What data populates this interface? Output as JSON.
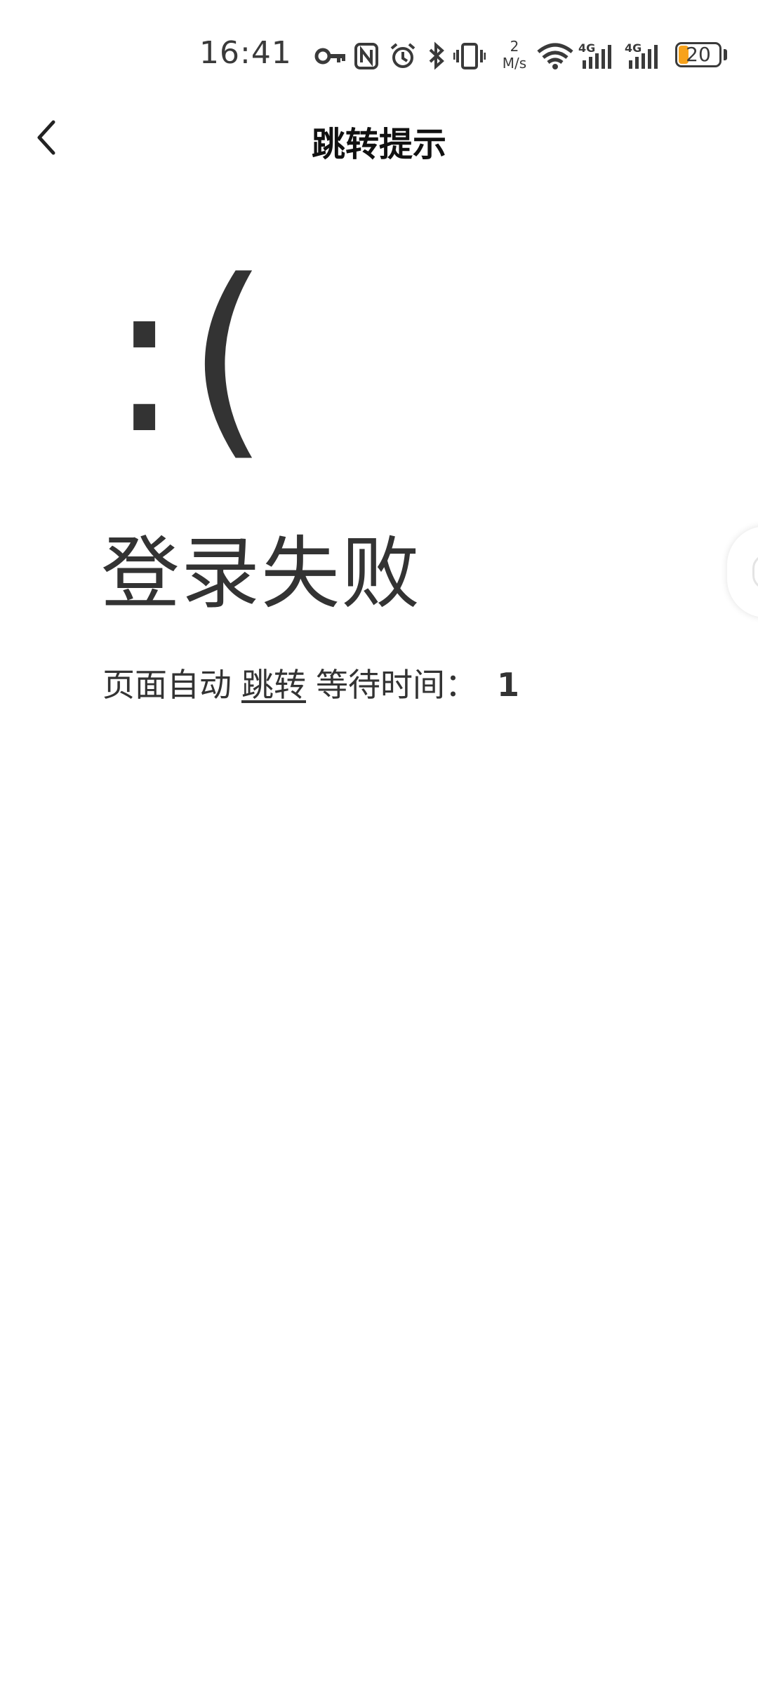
{
  "status_bar": {
    "time": "16:41",
    "net_speed_value": "2",
    "net_speed_unit": "M/s",
    "signal_1_label": "4G",
    "signal_2_label": "4G",
    "battery_level": "20",
    "battery_fill_color": "#f7a21b",
    "icons": [
      "vpn-key-icon",
      "nfc-icon",
      "alarm-icon",
      "bluetooth-icon",
      "vibrate-icon",
      "wifi-icon",
      "signal-4g-icon",
      "signal-4g-icon",
      "battery-icon"
    ]
  },
  "nav": {
    "title": "跳转提示",
    "back_icon": "chevron-left-icon"
  },
  "content": {
    "emoticon": ":(",
    "result_title": "登录失败",
    "redirect_prefix": "页面自动",
    "redirect_link": "跳转",
    "wait_label": "等待时间：",
    "countdown": "1"
  }
}
